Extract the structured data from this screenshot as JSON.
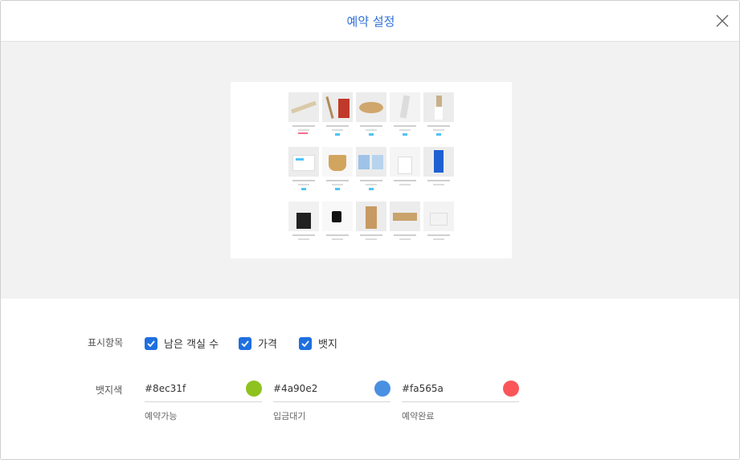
{
  "modal": {
    "title": "예약 설정"
  },
  "display_items": {
    "label": "표시항목",
    "options": [
      {
        "label": "남은 객실 수",
        "checked": true
      },
      {
        "label": "가격",
        "checked": true
      },
      {
        "label": "뱃지",
        "checked": true
      }
    ]
  },
  "badge_color": {
    "label": "뱃지색",
    "colors": [
      {
        "value": "#8ec31f",
        "caption": "예약가능"
      },
      {
        "value": "#4a90e2",
        "caption": "입금대기"
      },
      {
        "value": "#fa565a",
        "caption": "예약완료"
      }
    ]
  },
  "accent_color": "#1e6fe0"
}
